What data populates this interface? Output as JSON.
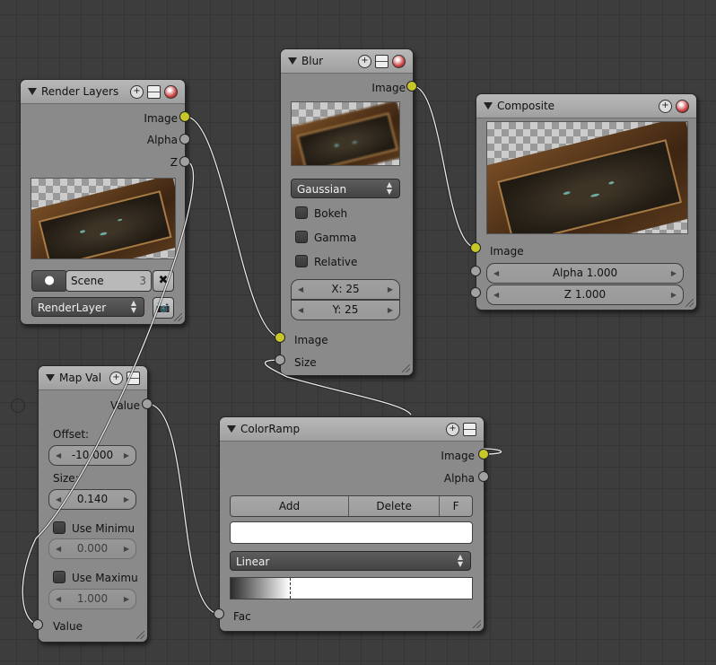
{
  "nodes": {
    "render_layers": {
      "title": "Render Layers",
      "outputs": [
        "Image",
        "Alpha",
        "Z"
      ],
      "scene_label": "Scene",
      "scene_users": "3",
      "layer_select": "RenderLayer"
    },
    "blur": {
      "title": "Blur",
      "output": "Image",
      "filter_type": "Gaussian",
      "options": [
        "Bokeh",
        "Gamma",
        "Relative"
      ],
      "x_field": "X: 25",
      "y_field": "Y: 25",
      "inputs": [
        "Image",
        "Size"
      ]
    },
    "composite": {
      "title": "Composite",
      "input_image": "Image",
      "alpha_field": "Alpha 1.000",
      "z_field": "Z 1.000"
    },
    "map_value": {
      "title": "Map Val",
      "output": "Value",
      "offset_label": "Offset:",
      "offset_value": "-10.000",
      "size_label": "Size:",
      "size_value": "0.140",
      "use_min_label": "Use Minimu",
      "min_value": "0.000",
      "use_max_label": "Use Maximu",
      "max_value": "1.000",
      "input": "Value"
    },
    "color_ramp": {
      "title": "ColorRamp",
      "outputs": [
        "Image",
        "Alpha"
      ],
      "buttons": [
        "Add",
        "Delete",
        "F"
      ],
      "interpolation": "Linear",
      "input": "Fac"
    }
  },
  "icons": {
    "collapse": "triangle-down-icon",
    "add": "plus-icon",
    "options": "node-options-icon",
    "preview": "preview-sphere-icon",
    "scene": "scene-icon",
    "unlink": "x-icon",
    "render": "camera-icon"
  },
  "colors": {
    "image_socket": "#c7c729",
    "value_socket": "#a1a1a1",
    "node_body": "#8a8a8a",
    "node_header": "#ababab",
    "canvas": "#3d3d3d"
  }
}
